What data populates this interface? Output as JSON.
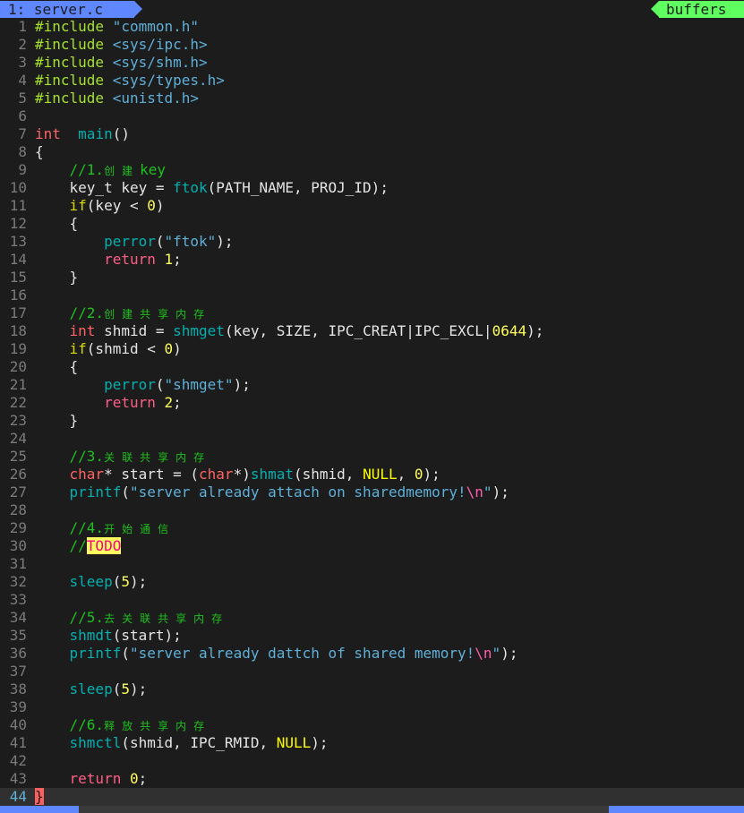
{
  "tabline": {
    "active_tab": "1: server.c",
    "buffers_label": "buffers"
  },
  "colors": {
    "tab_active": "#5f87ff",
    "buffers": "#5fff5f",
    "background": "#1c1c1c",
    "todo_bg": "#ffff5f"
  },
  "cursor": {
    "line": 44
  },
  "lines": [
    [
      [
        "pre",
        "#include "
      ],
      [
        "str",
        "\"common.h\""
      ]
    ],
    [
      [
        "pre",
        "#include "
      ],
      [
        "str",
        "<sys/ipc.h>"
      ]
    ],
    [
      [
        "pre",
        "#include "
      ],
      [
        "str",
        "<sys/shm.h>"
      ]
    ],
    [
      [
        "pre",
        "#include "
      ],
      [
        "str",
        "<sys/types.h>"
      ]
    ],
    [
      [
        "pre",
        "#include "
      ],
      [
        "str",
        "<unistd.h>"
      ]
    ],
    [],
    [
      [
        "ty",
        "int"
      ],
      [
        "",
        "  "
      ],
      [
        "fn",
        "main"
      ],
      [
        "",
        "()"
      ]
    ],
    [
      [
        "",
        "{"
      ]
    ],
    [
      [
        "",
        "    "
      ],
      [
        "cm",
        "//1."
      ],
      [
        "cjk",
        "创建"
      ],
      [
        "cm",
        "key"
      ]
    ],
    [
      [
        "",
        "    key_t key = "
      ],
      [
        "fn",
        "ftok"
      ],
      [
        "",
        "(PATH_NAME, PROJ_ID);"
      ]
    ],
    [
      [
        "",
        "    "
      ],
      [
        "cond",
        "if"
      ],
      [
        "",
        "(key < "
      ],
      [
        "num",
        "0"
      ],
      [
        "",
        ")"
      ]
    ],
    [
      [
        "",
        "    {"
      ]
    ],
    [
      [
        "",
        "        "
      ],
      [
        "fn",
        "perror"
      ],
      [
        "",
        "("
      ],
      [
        "str",
        "\"ftok\""
      ],
      [
        "",
        ");"
      ]
    ],
    [
      [
        "",
        "        "
      ],
      [
        "kw",
        "return"
      ],
      [
        "",
        " "
      ],
      [
        "num",
        "1"
      ],
      [
        "",
        ";"
      ]
    ],
    [
      [
        "",
        "    }"
      ]
    ],
    [],
    [
      [
        "",
        "    "
      ],
      [
        "cm",
        "//2."
      ],
      [
        "cjk",
        "创建共享内存"
      ]
    ],
    [
      [
        "",
        "    "
      ],
      [
        "ty",
        "int"
      ],
      [
        "",
        " shmid = "
      ],
      [
        "fn",
        "shmget"
      ],
      [
        "",
        "(key, SIZE, IPC_CREAT|IPC_EXCL|"
      ],
      [
        "num",
        "0644"
      ],
      [
        "",
        ");"
      ]
    ],
    [
      [
        "",
        "    "
      ],
      [
        "cond",
        "if"
      ],
      [
        "",
        "(shmid < "
      ],
      [
        "num",
        "0"
      ],
      [
        "",
        ")"
      ]
    ],
    [
      [
        "",
        "    {"
      ]
    ],
    [
      [
        "",
        "        "
      ],
      [
        "fn",
        "perror"
      ],
      [
        "",
        "("
      ],
      [
        "str",
        "\"shmget\""
      ],
      [
        "",
        ");"
      ]
    ],
    [
      [
        "",
        "        "
      ],
      [
        "kw",
        "return"
      ],
      [
        "",
        " "
      ],
      [
        "num",
        "2"
      ],
      [
        "",
        ";"
      ]
    ],
    [
      [
        "",
        "    }"
      ]
    ],
    [],
    [
      [
        "",
        "    "
      ],
      [
        "cm",
        "//3."
      ],
      [
        "cjk",
        "关联共享内存"
      ]
    ],
    [
      [
        "",
        "    "
      ],
      [
        "ty",
        "char"
      ],
      [
        "",
        "* start = ("
      ],
      [
        "ty",
        "char"
      ],
      [
        "",
        "*)"
      ],
      [
        "fn",
        "shmat"
      ],
      [
        "",
        "(shmid, "
      ],
      [
        "const",
        "NULL"
      ],
      [
        "",
        ", "
      ],
      [
        "num",
        "0"
      ],
      [
        "",
        ");"
      ]
    ],
    [
      [
        "",
        "    "
      ],
      [
        "fn",
        "printf"
      ],
      [
        "",
        "("
      ],
      [
        "str",
        "\"server already attach on sharedmemory!"
      ],
      [
        "esc",
        "\\n"
      ],
      [
        "str",
        "\""
      ],
      [
        "",
        ");"
      ]
    ],
    [],
    [
      [
        "",
        "    "
      ],
      [
        "cm",
        "//4."
      ],
      [
        "cjk",
        "开始通信"
      ]
    ],
    [
      [
        "",
        "    "
      ],
      [
        "cm",
        "//"
      ],
      [
        "todo",
        "TODO"
      ]
    ],
    [],
    [
      [
        "",
        "    "
      ],
      [
        "fn",
        "sleep"
      ],
      [
        "",
        "("
      ],
      [
        "num",
        "5"
      ],
      [
        "",
        ");"
      ]
    ],
    [],
    [
      [
        "",
        "    "
      ],
      [
        "cm",
        "//5."
      ],
      [
        "cjk",
        "去关联共享内存"
      ]
    ],
    [
      [
        "",
        "    "
      ],
      [
        "fn",
        "shmdt"
      ],
      [
        "",
        "(start);"
      ]
    ],
    [
      [
        "",
        "    "
      ],
      [
        "fn",
        "printf"
      ],
      [
        "",
        "("
      ],
      [
        "str",
        "\"server already dattch of shared memory!"
      ],
      [
        "esc",
        "\\n"
      ],
      [
        "str",
        "\""
      ],
      [
        "",
        ");"
      ]
    ],
    [],
    [
      [
        "",
        "    "
      ],
      [
        "fn",
        "sleep"
      ],
      [
        "",
        "("
      ],
      [
        "num",
        "5"
      ],
      [
        "",
        ");"
      ]
    ],
    [],
    [
      [
        "",
        "    "
      ],
      [
        "cm",
        "//6."
      ],
      [
        "cjk",
        "释放共享内存"
      ]
    ],
    [
      [
        "",
        "    "
      ],
      [
        "fn",
        "shmctl"
      ],
      [
        "",
        "(shmid, IPC_RMID, "
      ],
      [
        "const",
        "NULL"
      ],
      [
        "",
        ");"
      ]
    ],
    [],
    [
      [
        "",
        "    "
      ],
      [
        "kw",
        "return"
      ],
      [
        "",
        " "
      ],
      [
        "num",
        "0"
      ],
      [
        "",
        ";"
      ]
    ],
    [
      [
        "cursor",
        "}"
      ]
    ]
  ]
}
